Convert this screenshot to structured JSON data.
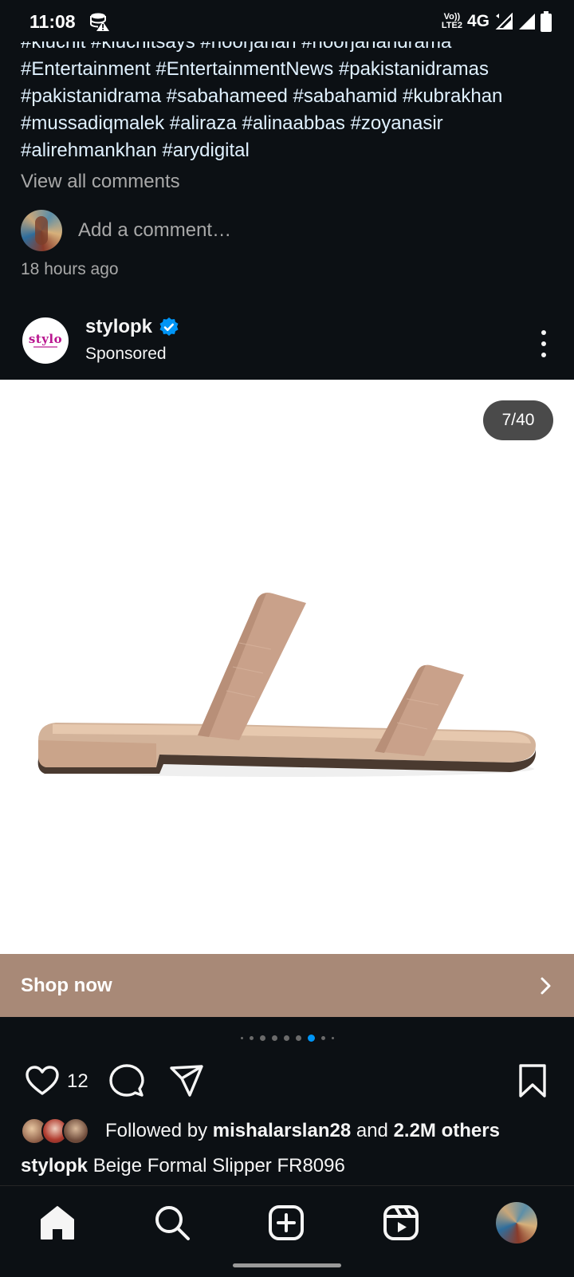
{
  "status_bar": {
    "time": "11:08",
    "volte": "Vo))\nLTE2",
    "network": "4G"
  },
  "caption": {
    "hashtags_line1": "#kluchit #kluchitsays #noorjahan #noorjahandrama",
    "hashtags_line2": "#Entertainment #EntertainmentNews #pakistanidramas",
    "hashtags_line3": "#pakistanidrama #sabahameed #sabahamid #kubrakhan",
    "hashtags_line4": "#mussadiqmalek #aliraza #alinaabbas #zoyanasir",
    "hashtags_line5": "#alirehmankhan #arydigital"
  },
  "comments": {
    "view_all": "View all comments",
    "add_placeholder": "Add a comment…",
    "timestamp": "18 hours ago"
  },
  "post": {
    "brand_logo_text": "stylo",
    "username": "stylopk",
    "label": "Sponsored",
    "media_counter": "7/40",
    "cta": "Shop now",
    "like_count": "12",
    "followed_by_prefix": "Followed by",
    "followed_by_user": "mishalarslan28",
    "followed_by_and": "and",
    "followed_by_others": "2.2M others",
    "caption_username": "stylopk",
    "caption_text": "Beige Formal Slipper FR8096"
  },
  "carousel": {
    "active_index": 5,
    "total_visible_dots": 7
  },
  "colors": {
    "background": "#0c1014",
    "text": "#f5f5f5",
    "muted": "#a8a8a8",
    "hashtag": "#e0f1ff",
    "cta_bar": "#a88977",
    "accent_blue": "#0095f6",
    "product_tan": "#c9a18a"
  },
  "icons": {
    "status_left": "data-saver-warning-icon",
    "signal": "signal-icon",
    "battery": "battery-icon",
    "verified": "verified-badge-icon",
    "more": "more-options-icon",
    "chevron": "chevron-right-icon",
    "like": "heart-icon",
    "comment": "comment-icon",
    "share": "share-send-icon",
    "save": "bookmark-icon",
    "nav_home": "home-icon",
    "nav_search": "search-icon",
    "nav_create": "create-icon",
    "nav_reels": "reels-icon"
  }
}
